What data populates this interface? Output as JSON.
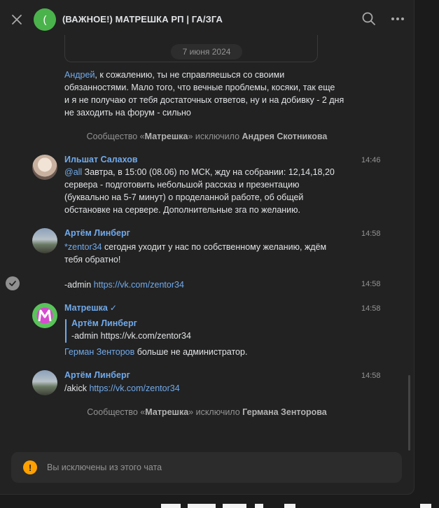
{
  "header": {
    "title": "(ВАЖНОЕ!) МАТРЕШКА РП | ГА/ЗГА",
    "avatar_letter": "(",
    "avatar_color": "#4bb34b",
    "icons": [
      "close-icon",
      "search-icon",
      "more-icon"
    ]
  },
  "date_divider": "7 июня 2024",
  "messages": {
    "m1": {
      "mention": "Андрей",
      "line1": ", к сожалению, ты не справляешься со своими",
      "line2": "обязанностями. Мало того, что вечные проблемы, косяки, так еще",
      "line3": "и я не получаю от тебя достаточных ответов, ну и на добивку - 2 дня",
      "line4": "не заходить на форум - сильно"
    },
    "s1": {
      "prefix": "Сообщество «",
      "community": "Матрешка",
      "middle": "» исключило ",
      "person": "Андрея Скотникова"
    },
    "m2": {
      "author": "Ильшат Салахов",
      "time": "14:46",
      "mention": "@all",
      "line1": " Завтра, в 15:00 (08.06) по МСК, жду на собрании: 12,14,18,20",
      "line2": "сервера - подготовить небольшой рассказ и презентацию",
      "line3": "(буквально на 5-7 минут) о проделанной работе, об общей",
      "line4": "обстановке на сервере. Дополнительные зга по желанию."
    },
    "m3": {
      "author": "Артём Линберг",
      "time": "14:58",
      "mention": "*zentor34",
      "line1": " сегодня уходит у нас по собственному желанию, ждём",
      "line2": "тебя обратно!"
    },
    "m4": {
      "text": "-admin ",
      "link": "https://vk.com/zentor34",
      "time": "14:58"
    },
    "m5": {
      "author": "Матрешка",
      "verified": "✓",
      "time": "14:58",
      "reply_author": "Артём Линберг",
      "reply_text": "-admin https://vk.com/zentor34",
      "mention": "Герман Зенторов",
      "text": " больше не администратор."
    },
    "m6": {
      "author": "Артём Линберг",
      "time": "14:58",
      "text": "/akick ",
      "link": "https://vk.com/zentor34"
    },
    "s2": {
      "prefix": "Сообщество «",
      "community": "Матрешка",
      "middle": "» исключило ",
      "person": "Германа Зенторова"
    }
  },
  "notice": {
    "icon": "info-icon",
    "text": "Вы исключены из этого чата",
    "icon_color": "#ffa000"
  },
  "colors": {
    "background": "#222222",
    "link": "#71aaeb",
    "service_text": "#939393"
  }
}
